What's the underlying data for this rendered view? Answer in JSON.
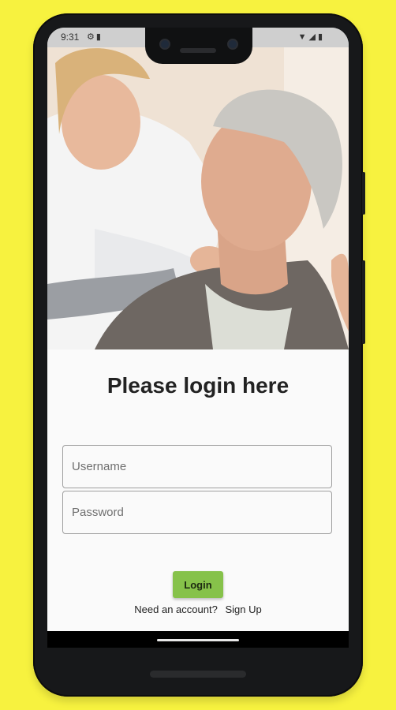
{
  "status": {
    "time": "9:31",
    "left_icons": [
      "settings-icon",
      "sim-icon"
    ],
    "right_icons": [
      "wifi-icon",
      "signal-icon",
      "battery-icon"
    ]
  },
  "hero": {
    "icon": "caregiver-photo"
  },
  "login": {
    "title": "Please login here",
    "username_placeholder": "Username",
    "password_placeholder": "Password",
    "username_value": "",
    "password_value": "",
    "button_label": "Login",
    "account_prompt": "Need an account?",
    "signup_label": "Sign Up"
  },
  "colors": {
    "background": "#f7f23f",
    "accent": "#86c24a"
  }
}
